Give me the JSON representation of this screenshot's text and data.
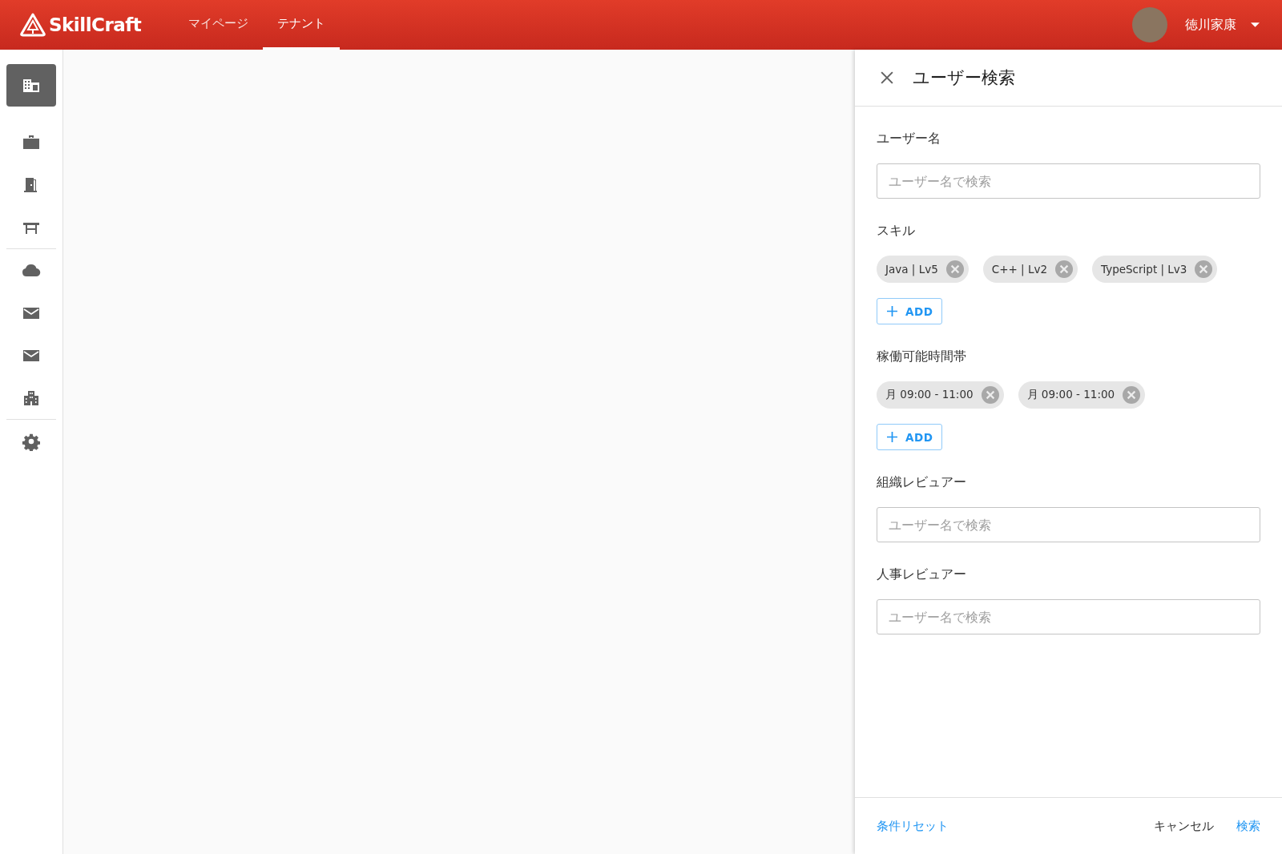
{
  "header": {
    "logo": "SkillCraft",
    "nav": [
      {
        "label": "マイページ",
        "selected": false
      },
      {
        "label": "テナント",
        "selected": true
      }
    ],
    "user": {
      "name": "徳川家康"
    }
  },
  "sidebar": {
    "groups": [
      [
        {
          "selected": true
        },
        {
          "selected": false
        },
        {
          "selected": false
        },
        {
          "selected": false
        }
      ],
      [
        {
          "selected": false
        },
        {
          "selected": false
        },
        {
          "selected": false
        },
        {
          "selected": false
        }
      ],
      [
        {
          "selected": false
        }
      ]
    ]
  },
  "panel": {
    "title": "ユーザー検索",
    "sections": [
      {
        "kind": "text",
        "label": "ユーザー名",
        "placeholder": "ユーザー名で検索"
      },
      {
        "kind": "chips",
        "label": "スキル",
        "chips": [
          "Java | Lv5",
          "C++ | Lv2",
          "TypeScript | Lv3"
        ],
        "add": "ADD"
      },
      {
        "kind": "chips",
        "label": "稼働可能時間帯",
        "chips": [
          "月 09:00 - 11:00",
          "月 09:00 - 11:00"
        ],
        "add": "ADD"
      },
      {
        "kind": "text",
        "label": "組織レビュアー",
        "placeholder": "ユーザー名で検索"
      },
      {
        "kind": "text",
        "label": "人事レビュアー",
        "placeholder": "ユーザー名で検索"
      }
    ],
    "footer": {
      "reset": "条件リセット",
      "cancel": "キャンセル",
      "search": "検索"
    }
  }
}
